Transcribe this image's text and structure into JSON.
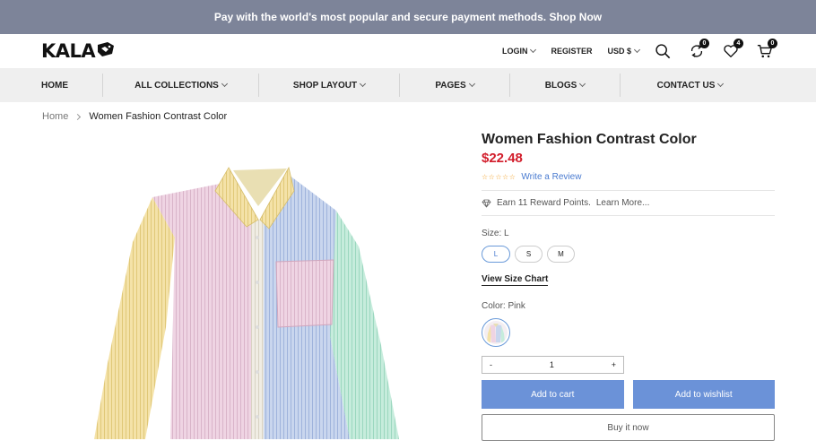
{
  "announcement": "Pay with the world's most popular and secure payment methods. Shop Now",
  "header": {
    "logo": "KALA",
    "login": "LOGIN",
    "register": "REGISTER",
    "currency": "USD $",
    "compare_count": "0",
    "wishlist_count": "4",
    "cart_count": "0"
  },
  "nav": {
    "items": [
      {
        "label": "HOME"
      },
      {
        "label": "ALL COLLECTIONS"
      },
      {
        "label": "SHOP LAYOUT"
      },
      {
        "label": "PAGES"
      },
      {
        "label": "BLOGS"
      },
      {
        "label": "CONTACT US"
      }
    ]
  },
  "breadcrumb": {
    "home": "Home",
    "current": "Women Fashion Contrast Color"
  },
  "product": {
    "title": "Women Fashion Contrast Color",
    "price": "$22.48",
    "rating": 0,
    "stars": "☆☆☆☆☆",
    "review_link": "Write a Review",
    "reward_text": "Earn 11 Reward Points.",
    "learn_more": "Learn More...",
    "size_label": "Size: L",
    "sizes": [
      "L",
      "S",
      "M"
    ],
    "size_chart": "View Size Chart",
    "color_label": "Color: Pink",
    "quantity": "1",
    "minus": "-",
    "plus": "+",
    "add_to_cart": "Add to cart",
    "add_to_wishlist": "Add to wishlist",
    "buy_now": "Buy it now"
  },
  "colors": {
    "topbar": "#7d8499",
    "accent": "#6b92d8",
    "price": "#d21d2b",
    "stars": "#f3a531"
  }
}
